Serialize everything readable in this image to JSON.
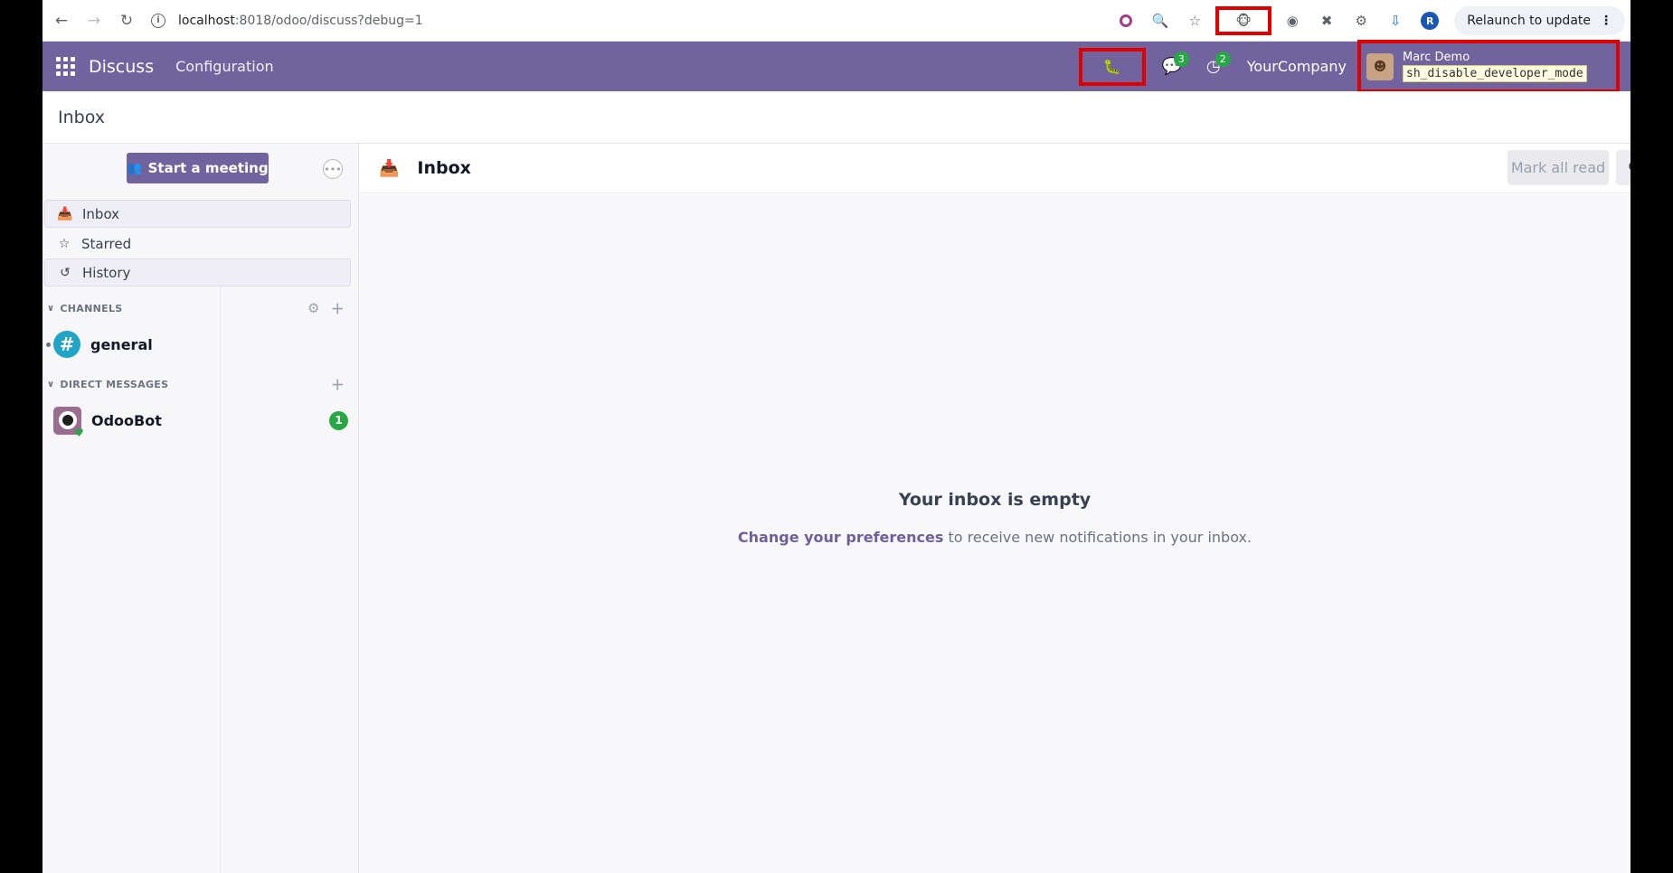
{
  "browser": {
    "url_host": "localhost",
    "url_path": ":8018/odoo/discuss?debug=1",
    "relaunch_label": "Relaunch to update",
    "profile_initial": "R"
  },
  "navbar": {
    "app_name": "Discuss",
    "menu_configuration": "Configuration",
    "messages_count": "3",
    "activities_count": "2",
    "company": "YourCompany",
    "user_name": "Marc Demo",
    "user_db": "sh_disable_developer_mode"
  },
  "control_panel": {
    "breadcrumb": "Inbox"
  },
  "sidebar": {
    "start_meeting_label": "Start a meeting",
    "mailboxes": [
      {
        "label": "Inbox",
        "icon": "inbox-icon"
      },
      {
        "label": "Starred",
        "icon": "star-icon"
      },
      {
        "label": "History",
        "icon": "history-icon"
      }
    ],
    "channels_header": "CHANNELS",
    "channels": [
      {
        "name": "general"
      }
    ],
    "dm_header": "DIRECT MESSAGES",
    "direct_messages": [
      {
        "name": "OdooBot",
        "unread": "1"
      }
    ]
  },
  "main": {
    "title": "Inbox",
    "mark_all_read": "Mark all read",
    "empty_title": "Your inbox is empty",
    "empty_link": "Change your preferences",
    "empty_rest": " to receive new notifications in your inbox."
  },
  "colors": {
    "brand": "#71639e",
    "success": "#28a745",
    "channel": "#20a5c7",
    "highlight": "#e00000"
  }
}
